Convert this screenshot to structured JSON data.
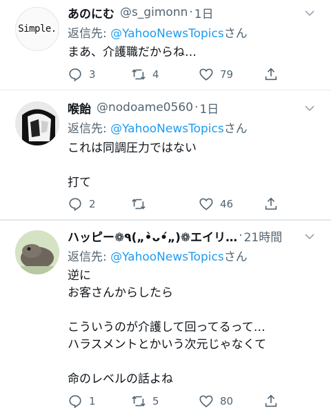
{
  "tweets": [
    {
      "name": "あのにむ",
      "handle": "@s_gimonn",
      "time": "1日",
      "avatar_text": "Simple.",
      "reply_prefix": "返信先:",
      "reply_to": "@YahooNewsTopics",
      "reply_suffix": "さん",
      "body": "まあ、介護職だからね…",
      "replies": "3",
      "retweets": "4",
      "likes": "79"
    },
    {
      "name": "喉飴",
      "handle": "@nodoame0560",
      "time": "1日",
      "reply_prefix": "返信先:",
      "reply_to": "@YahooNewsTopics",
      "reply_suffix": "さん",
      "body": "これは同調圧力ではない\n\n打て",
      "replies": "2",
      "retweets": "",
      "likes": "46"
    },
    {
      "name": "ハッピー❁٩(„•̀ᴗ•́„)❁エイリ…",
      "handle": "",
      "time": "21時間",
      "reply_prefix": "返信先:",
      "reply_to": "@YahooNewsTopics",
      "reply_suffix": "さん",
      "body": "逆に\nお客さんからしたら\n\nこういうのが介護して回ってるって…\nハラスメントとかいう次元じゃなくて\n\n命のレベルの話よね",
      "replies": "1",
      "retweets": "5",
      "likes": "80"
    }
  ],
  "colors": {
    "link": "#1d9bf0",
    "secondary": "#536471",
    "divider": "#e6ecf0"
  },
  "icons": [
    "reply-icon",
    "retweet-icon",
    "like-icon",
    "share-icon",
    "chevron-down-icon"
  ]
}
